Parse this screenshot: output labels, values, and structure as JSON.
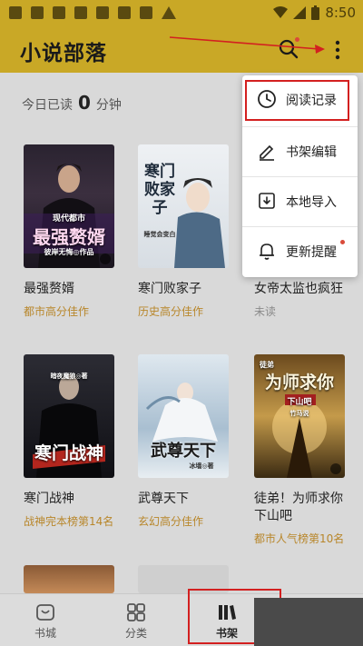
{
  "status_bar": {
    "time": "8:50"
  },
  "header": {
    "title": "小说部落"
  },
  "reading": {
    "prefix": "今日已读",
    "minutes": "0",
    "unit": "分钟"
  },
  "books": [
    {
      "title": "最强赘婿",
      "tag": "都市高分佳作",
      "cover_text": "最强赘婿",
      "cover_sub": "现代都市",
      "cover_author": "彼岸无悔◎作品"
    },
    {
      "title": "寒门败家子",
      "tag": "历史高分佳作",
      "cover_text": "寒门败家子",
      "cover_author": "睡觉会变白"
    },
    {
      "title": "女帝太监也疯狂",
      "tag": "未读",
      "cover_text": ""
    },
    {
      "title": "寒门战神",
      "tag": "战神完本榜第14名",
      "cover_text": "寒门战神",
      "cover_author": "暗夜魔狼◎著"
    },
    {
      "title": "武尊天下",
      "tag": "玄幻高分佳作",
      "cover_text": "武尊天下",
      "cover_author": "冰墙◎著"
    },
    {
      "title": "徒弟！为师求你下山吧",
      "tag": "都市人气榜第10名",
      "cover_text": "为师求你",
      "cover_sub": "徒弟",
      "cover_banner": "下山吧",
      "cover_author": "竹马说"
    }
  ],
  "menu": {
    "items": [
      {
        "label": "阅读记录",
        "icon": "clock-icon"
      },
      {
        "label": "书架编辑",
        "icon": "pen-icon"
      },
      {
        "label": "本地导入",
        "icon": "import-icon"
      },
      {
        "label": "更新提醒",
        "icon": "bell-icon"
      }
    ]
  },
  "nav": {
    "items": [
      {
        "label": "书城",
        "icon": "store-icon"
      },
      {
        "label": "分类",
        "icon": "grid-icon"
      },
      {
        "label": "书架",
        "icon": "bookshelf-icon",
        "active": true
      }
    ]
  },
  "colors": {
    "brand": "#c9a826",
    "accent_text": "#b8862a",
    "annotation": "#d32020"
  }
}
